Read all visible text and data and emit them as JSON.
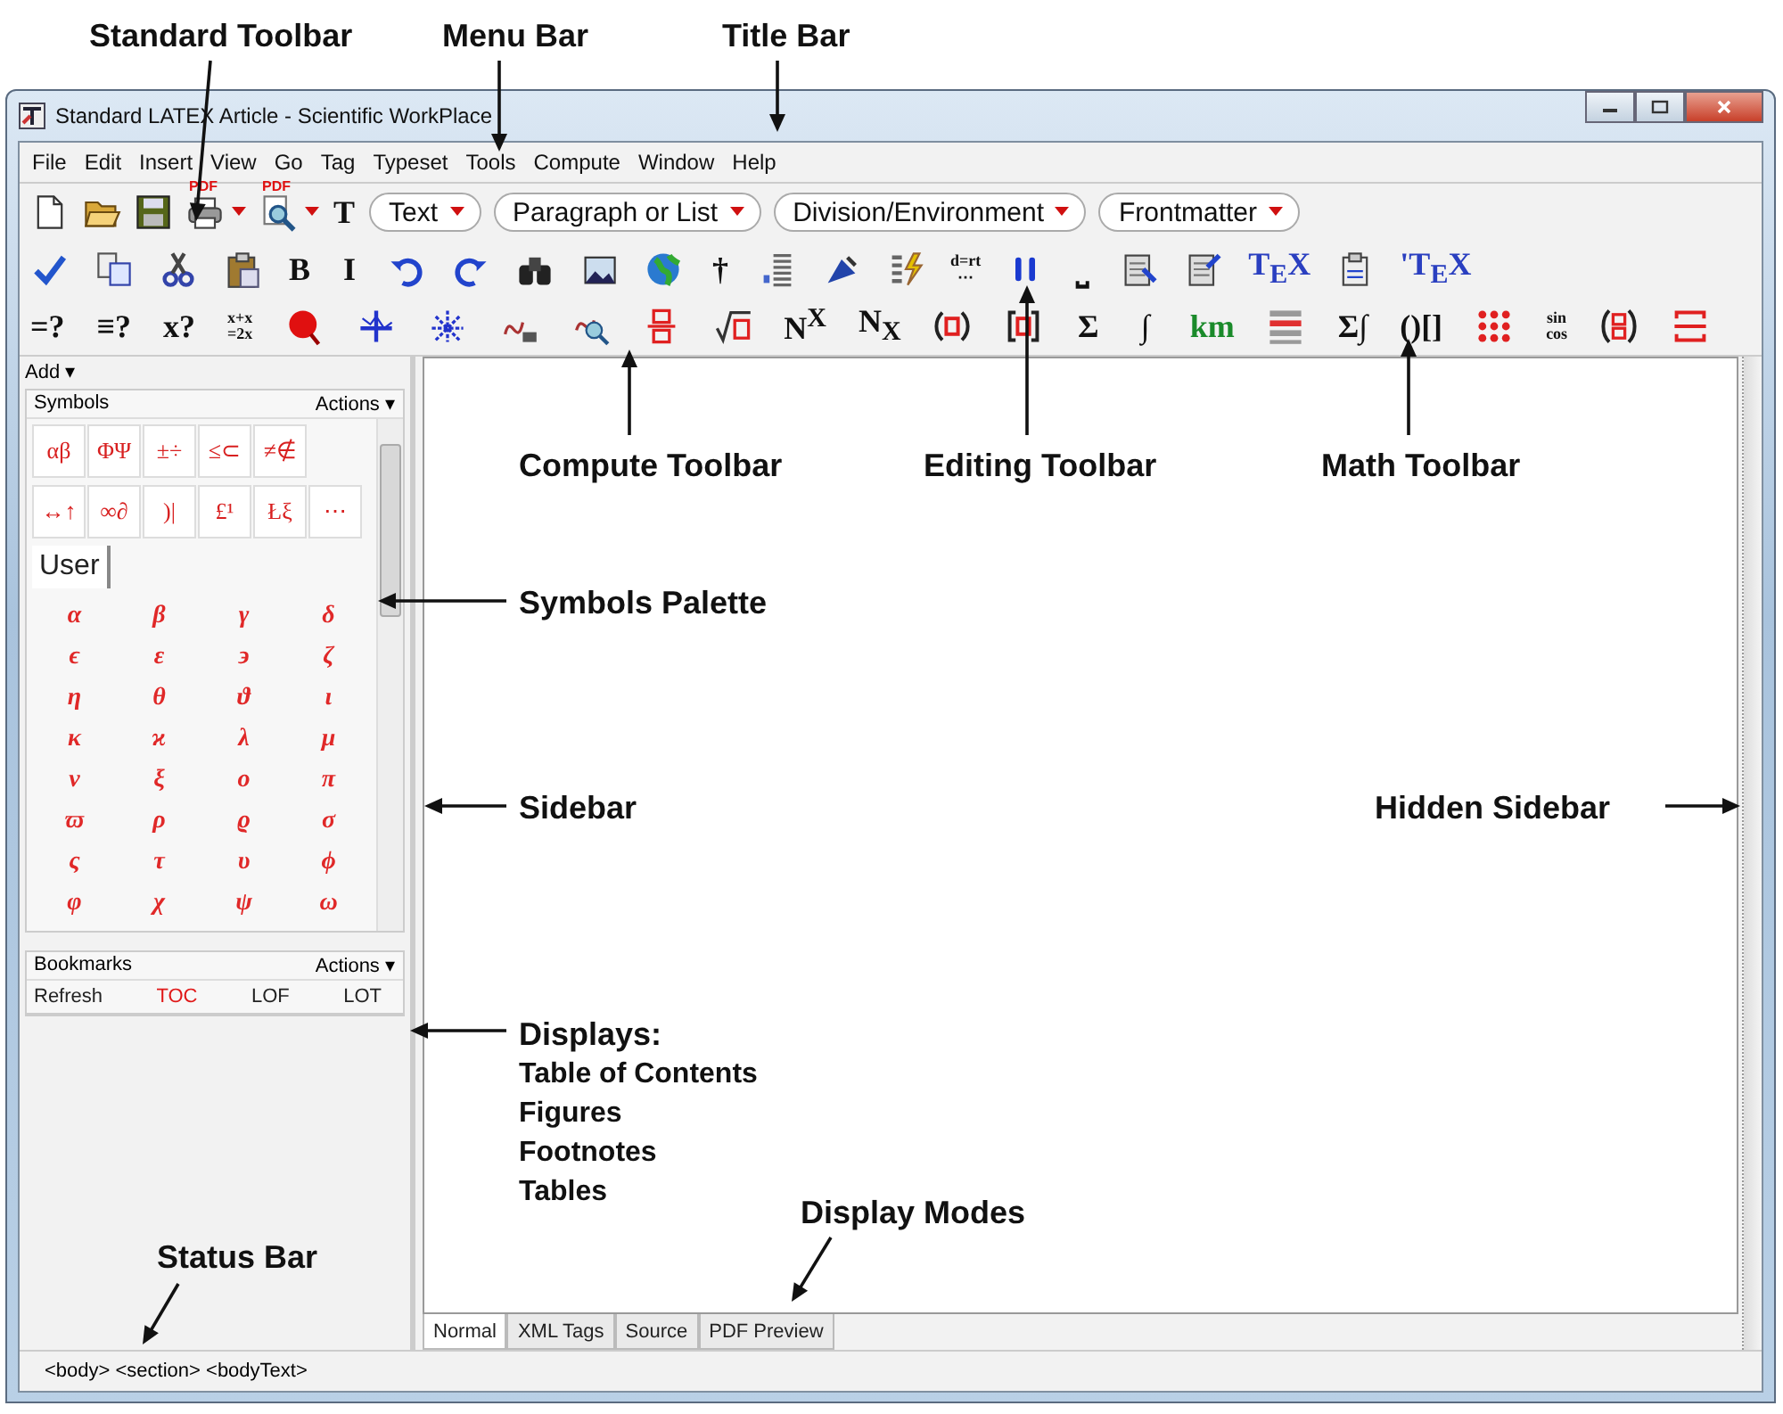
{
  "window": {
    "title": "Standard LATEX Article - Scientific WorkPlace"
  },
  "menu": [
    "File",
    "Edit",
    "Insert",
    "View",
    "Go",
    "Tag",
    "Typeset",
    "Tools",
    "Compute",
    "Window",
    "Help"
  ],
  "toolbars": [
    {
      "items": [
        {
          "kind": "icon"
        },
        {
          "kind": "icon"
        },
        {
          "kind": "icon"
        },
        {
          "kind": "icon",
          "badge": "PDF"
        },
        {
          "kind": "caret"
        },
        {
          "kind": "icon",
          "badge": "PDF"
        },
        {
          "kind": "caret"
        },
        {
          "kind": "glyph",
          "text": "T"
        },
        {
          "kind": "select",
          "text": "Text"
        },
        {
          "kind": "select",
          "text": "Paragraph or List"
        },
        {
          "kind": "select",
          "text": "Division/Environment"
        },
        {
          "kind": "select",
          "text": "Frontmatter"
        }
      ]
    },
    {
      "items": [
        {
          "kind": "icon"
        },
        {
          "kind": "icon"
        },
        {
          "kind": "icon"
        },
        {
          "kind": "icon"
        },
        {
          "kind": "glyph",
          "text": "B"
        },
        {
          "kind": "glyph",
          "text": "I"
        },
        {
          "kind": "icon"
        },
        {
          "kind": "icon"
        },
        {
          "kind": "icon"
        },
        {
          "kind": "icon"
        },
        {
          "kind": "icon"
        },
        {
          "kind": "glyph",
          "text": "†"
        },
        {
          "kind": "icon"
        },
        {
          "kind": "icon"
        },
        {
          "kind": "icon"
        },
        {
          "kind": "stack",
          "lines": [
            "d=rt",
            "⋯"
          ]
        },
        {
          "kind": "icon"
        },
        {
          "kind": "glyph",
          "text": "⎵"
        },
        {
          "kind": "icon"
        },
        {
          "kind": "icon"
        },
        {
          "kind": "glyph",
          "text": "T$_{E}$X",
          "color": "#2a3fc0"
        },
        {
          "kind": "icon"
        },
        {
          "kind": "glyph",
          "text": "'T$_{E}$X",
          "color": "#2a3fc0"
        }
      ]
    },
    {
      "items": [
        {
          "kind": "glyph",
          "text": "=?"
        },
        {
          "kind": "glyph",
          "text": "≡?"
        },
        {
          "kind": "glyph",
          "text": "x?"
        },
        {
          "kind": "stack",
          "lines": [
            "x+x",
            "=2x"
          ]
        },
        {
          "kind": "icon"
        },
        {
          "kind": "icon"
        },
        {
          "kind": "icon"
        },
        {
          "kind": "icon"
        },
        {
          "kind": "icon"
        },
        {
          "kind": "icon"
        },
        {
          "kind": "icon"
        },
        {
          "kind": "glyph",
          "text": "N$^{X}$"
        },
        {
          "kind": "glyph",
          "text": "N$_{X}$"
        },
        {
          "kind": "icon"
        },
        {
          "kind": "icon"
        },
        {
          "kind": "glyph",
          "text": "Σ"
        },
        {
          "kind": "glyph",
          "text": "∫"
        },
        {
          "kind": "glyph",
          "text": "km",
          "color": "#1a8a2a"
        },
        {
          "kind": "icon"
        },
        {
          "kind": "glyph",
          "text": "Σ∫"
        },
        {
          "kind": "glyph",
          "text": "()[]"
        },
        {
          "kind": "icon"
        },
        {
          "kind": "stack",
          "lines": [
            "sin",
            "cos"
          ]
        },
        {
          "kind": "icon"
        },
        {
          "kind": "icon"
        }
      ]
    }
  ],
  "sidebar": {
    "add_label": "Add ▾",
    "symbols": {
      "title": "Symbols",
      "actions": "Actions ▾",
      "tab_rows": [
        [
          {
            "label": "αβ",
            "selected": false
          },
          {
            "label": "ΦΨ",
            "selected": false
          },
          {
            "label": "±÷",
            "selected": false
          },
          {
            "label": "≤⊂",
            "selected": false
          },
          {
            "label": "≠∉",
            "selected": false
          }
        ],
        [
          {
            "label": "↔↑",
            "selected": false
          },
          {
            "label": "∞∂",
            "selected": false
          },
          {
            "label": ")|",
            "selected": false
          },
          {
            "label": "£¹",
            "selected": false
          },
          {
            "label": "Łξ",
            "selected": false
          },
          {
            "label": "⋯",
            "selected": false
          }
        ],
        [
          {
            "label": "User",
            "selected": true
          }
        ]
      ],
      "grid": [
        [
          "α",
          "β",
          "γ",
          "δ"
        ],
        [
          "ϵ",
          "ε",
          "϶",
          "ζ"
        ],
        [
          "η",
          "θ",
          "ϑ",
          "ι"
        ],
        [
          "κ",
          "ϰ",
          "λ",
          "μ"
        ],
        [
          "ν",
          "ξ",
          "ο",
          "π"
        ],
        [
          "ϖ",
          "ρ",
          "ϱ",
          "σ"
        ],
        [
          "ς",
          "τ",
          "υ",
          "ϕ"
        ],
        [
          "φ",
          "χ",
          "ψ",
          "ω"
        ]
      ]
    },
    "bookmarks": {
      "title": "Bookmarks",
      "actions": "Actions ▾",
      "buttons": [
        {
          "label": "Refresh",
          "selected": false
        },
        {
          "label": "TOC",
          "selected": true
        },
        {
          "label": "LOF",
          "selected": false
        },
        {
          "label": "LOT",
          "selected": false
        }
      ]
    }
  },
  "display_tabs": [
    {
      "label": "Normal",
      "selected": true
    },
    {
      "label": "XML Tags",
      "selected": false
    },
    {
      "label": "Source",
      "selected": false
    },
    {
      "label": "PDF Preview",
      "selected": false
    }
  ],
  "status_bar": "<body> <section> <bodyText>",
  "callouts": [
    {
      "label": "Standard Toolbar"
    },
    {
      "label": "Menu Bar"
    },
    {
      "label": "Title Bar"
    },
    {
      "label": "Compute Toolbar"
    },
    {
      "label": "Editing Toolbar"
    },
    {
      "label": "Math Toolbar"
    },
    {
      "label": "Symbols Palette"
    },
    {
      "label": "Sidebar"
    },
    {
      "label": "Hidden Sidebar"
    },
    {
      "label": "Displays:",
      "lines": [
        "Table of Contents",
        "Figures",
        "Footnotes",
        "Tables"
      ]
    },
    {
      "label": "Display Modes"
    },
    {
      "label": "Status Bar"
    }
  ]
}
